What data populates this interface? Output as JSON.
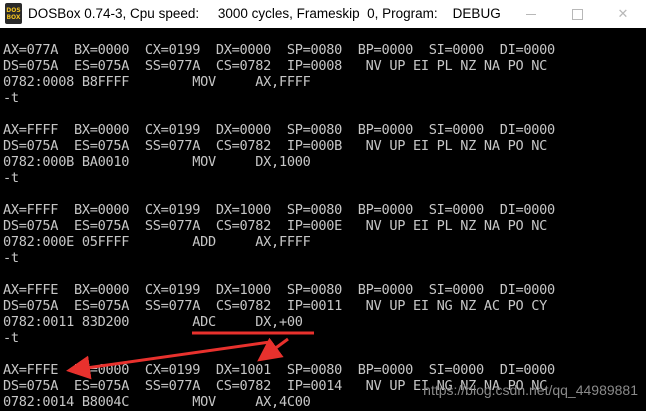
{
  "window": {
    "icon_text_top": "DOS",
    "icon_text_bottom": "BOX",
    "title": "DOSBox 0.74-3, Cpu speed:     3000 cycles, Frameskip  0, Program:    DEBUG",
    "minimize_icon": "minimize-icon",
    "maximize_icon": "maximize-icon",
    "close_glyph": "✕"
  },
  "console": {
    "lines": [
      "AX=077A  BX=0000  CX=0199  DX=0000  SP=0080  BP=0000  SI=0000  DI=0000",
      "DS=075A  ES=075A  SS=077A  CS=0782  IP=0008   NV UP EI PL NZ NA PO NC",
      "0782:0008 B8FFFF        MOV     AX,FFFF",
      "-t",
      "",
      "AX=FFFF  BX=0000  CX=0199  DX=0000  SP=0080  BP=0000  SI=0000  DI=0000",
      "DS=075A  ES=075A  SS=077A  CS=0782  IP=000B   NV UP EI PL NZ NA PO NC",
      "0782:000B BA0010        MOV     DX,1000",
      "-t",
      "",
      "AX=FFFF  BX=0000  CX=0199  DX=1000  SP=0080  BP=0000  SI=0000  DI=0000",
      "DS=075A  ES=075A  SS=077A  CS=0782  IP=000E   NV UP EI PL NZ NA PO NC",
      "0782:000E 05FFFF        ADD     AX,FFFF",
      "-t",
      "",
      "AX=FFFE  BX=0000  CX=0199  DX=1000  SP=0080  BP=0000  SI=0000  DI=0000",
      "DS=075A  ES=075A  SS=077A  CS=0782  IP=0011   NV UP EI NG NZ AC PO CY",
      "0782:0011 83D200        ADC     DX,+00",
      "-t",
      "",
      "AX=FFFE  BX=0000  CX=0199  DX=1001  SP=0080  BP=0000  SI=0000  DI=0000",
      "DS=075A  ES=075A  SS=077A  CS=0782  IP=0014   NV UP EI NG NZ NA PO NC",
      "0782:0014 B8004C        MOV     AX,4C00"
    ]
  },
  "annotation": {
    "color": "#e8312d"
  },
  "watermark": "https://blog.csdn.net/qq_44989881"
}
